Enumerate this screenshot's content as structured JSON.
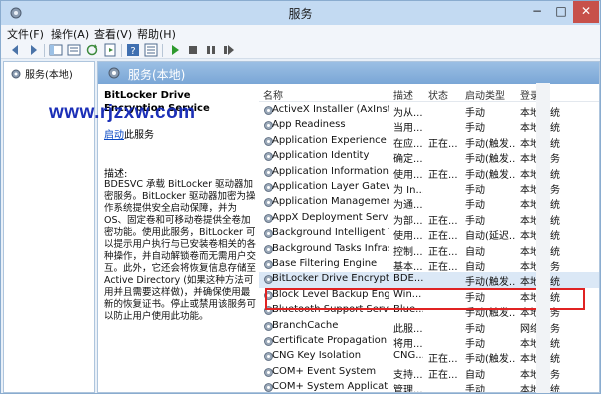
{
  "window": {
    "title": "服务",
    "min_label": "−",
    "max_label": "□",
    "close_label": "✕"
  },
  "menu": {
    "items": [
      "文件(F)",
      "操作(A)",
      "查看(V)",
      "帮助(H)"
    ]
  },
  "left_pane": {
    "item_label": "服务(本地)"
  },
  "main_pane": {
    "header_title": "服务(本地)",
    "selected_service_title": "BitLocker Drive Encryption Service",
    "start_link": "启动",
    "start_link_suffix": "此服务",
    "description_label": "描述:",
    "description_text": "BDESVC 承载 BitLocker 驱动器加密服务。BitLocker 驱动器加密为操作系统提供安全启动保障，并为 OS、固定卷和可移动卷提供全卷加密功能。使用此服务，BitLocker 可以提示用户执行与已安装卷相关的各种操作，并自动解锁卷而无需用户交互。此外，它还会将恢复信息存储至 Active Directory (如果这种方法可用并且需要这样做)，并确保使用最新的恢复证书。停止或禁用该服务可以防止用户使用此功能。"
  },
  "watermark": "www.rjzxw.com",
  "columns": {
    "name": "名称",
    "desc": "描述",
    "status": "状态",
    "startup": "启动类型",
    "logon": "登录为"
  },
  "services": [
    {
      "name": "ActiveX Installer (AxInstSV)",
      "desc": "为从...",
      "status": "",
      "startup": "手动",
      "logon": "本地系统"
    },
    {
      "name": "App Readiness",
      "desc": "当用...",
      "status": "",
      "startup": "手动",
      "logon": "本地系统"
    },
    {
      "name": "Application Experience",
      "desc": "在应...",
      "status": "正在...",
      "startup": "手动(触发...",
      "logon": "本地系统"
    },
    {
      "name": "Application Identity",
      "desc": "确定...",
      "status": "",
      "startup": "手动(触发...",
      "logon": "本地服务"
    },
    {
      "name": "Application Information",
      "desc": "使用...",
      "status": "正在...",
      "startup": "手动(触发...",
      "logon": "本地系统"
    },
    {
      "name": "Application Layer Gatewa...",
      "desc": "为 In...",
      "status": "",
      "startup": "手动",
      "logon": "本地服务"
    },
    {
      "name": "Application Management",
      "desc": "为通...",
      "status": "",
      "startup": "手动",
      "logon": "本地系统"
    },
    {
      "name": "AppX Deployment Servic...",
      "desc": "为部...",
      "status": "正在...",
      "startup": "手动",
      "logon": "本地系统"
    },
    {
      "name": "Background Intelligent T...",
      "desc": "使用...",
      "status": "正在...",
      "startup": "自动(延迟...",
      "logon": "本地系统"
    },
    {
      "name": "Background Tasks Infras...",
      "desc": "控制...",
      "status": "正在...",
      "startup": "自动",
      "logon": "本地系统"
    },
    {
      "name": "Base Filtering Engine",
      "desc": "基本...",
      "status": "正在...",
      "startup": "自动",
      "logon": "本地服务"
    },
    {
      "name": "BitLocker Drive Encryptio...",
      "desc": "BDE...",
      "status": "",
      "startup": "手动(触发...",
      "logon": "本地系统"
    },
    {
      "name": "Block Level Backup Engi...",
      "desc": "Win...",
      "status": "",
      "startup": "手动",
      "logon": "本地系统"
    },
    {
      "name": "Bluetooth Support Service",
      "desc": "Blue...",
      "status": "",
      "startup": "手动(触发...",
      "logon": "本地服务"
    },
    {
      "name": "BranchCache",
      "desc": "此服...",
      "status": "",
      "startup": "手动",
      "logon": "网络服务"
    },
    {
      "name": "Certificate Propagation",
      "desc": "将用...",
      "status": "",
      "startup": "手动",
      "logon": "本地系统"
    },
    {
      "name": "CNG Key Isolation",
      "desc": "CNG...",
      "status": "正在...",
      "startup": "手动(触发...",
      "logon": "本地系统"
    },
    {
      "name": "COM+ Event System",
      "desc": "支持...",
      "status": "正在...",
      "startup": "自动",
      "logon": "本地服务"
    },
    {
      "name": "COM+ System Application",
      "desc": "管理...",
      "status": "",
      "startup": "手动",
      "logon": "本地系统"
    }
  ],
  "colors": {
    "header_blue": "#7aa6d6",
    "highlight_red": "#e02323",
    "link_blue": "#0646c2",
    "watermark_blue": "#1b2fb7"
  }
}
